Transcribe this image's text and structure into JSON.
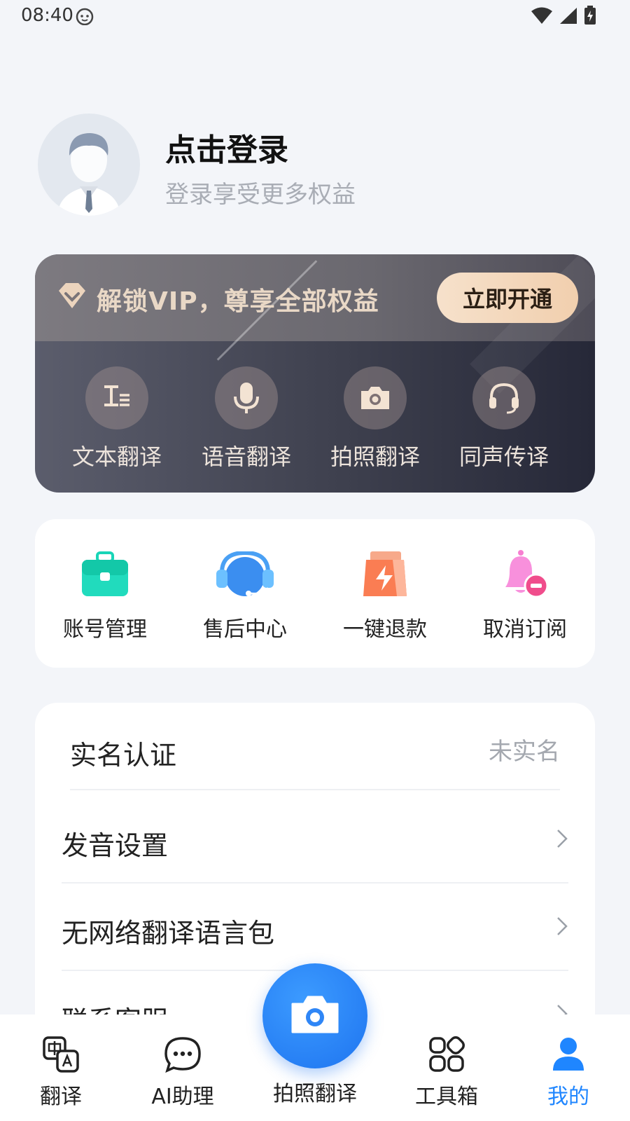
{
  "status": {
    "time": "08:40"
  },
  "profile": {
    "title": "点击登录",
    "subtitle": "登录享受更多权益"
  },
  "vip": {
    "banner": "解锁VIP，尊享全部权益",
    "button": "立即开通",
    "features": [
      {
        "label": "文本翻译",
        "icon": "text-translate-icon"
      },
      {
        "label": "语音翻译",
        "icon": "microphone-icon"
      },
      {
        "label": "拍照翻译",
        "icon": "camera-icon"
      },
      {
        "label": "同声传译",
        "icon": "headset-icon"
      }
    ]
  },
  "services": [
    {
      "label": "账号管理",
      "icon": "briefcase-icon"
    },
    {
      "label": "售后中心",
      "icon": "headset-icon"
    },
    {
      "label": "一键退款",
      "icon": "refund-bag-icon"
    },
    {
      "label": "取消订阅",
      "icon": "bell-minus-icon"
    }
  ],
  "settings": {
    "realname": {
      "label": "实名认证",
      "value": "未实名"
    },
    "items": [
      {
        "label": "发音设置"
      },
      {
        "label": "无网络翻译语言包"
      },
      {
        "label": "联系客服"
      }
    ]
  },
  "nav": {
    "items": [
      {
        "label": "翻译",
        "icon": "translate-icon"
      },
      {
        "label": "AI助理",
        "icon": "chat-bubble-icon"
      },
      {
        "label": "拍照翻译",
        "icon": "camera-icon"
      },
      {
        "label": "工具箱",
        "icon": "toolbox-icon"
      },
      {
        "label": "我的",
        "icon": "person-icon"
      }
    ],
    "active_color": "#1f86ff"
  }
}
